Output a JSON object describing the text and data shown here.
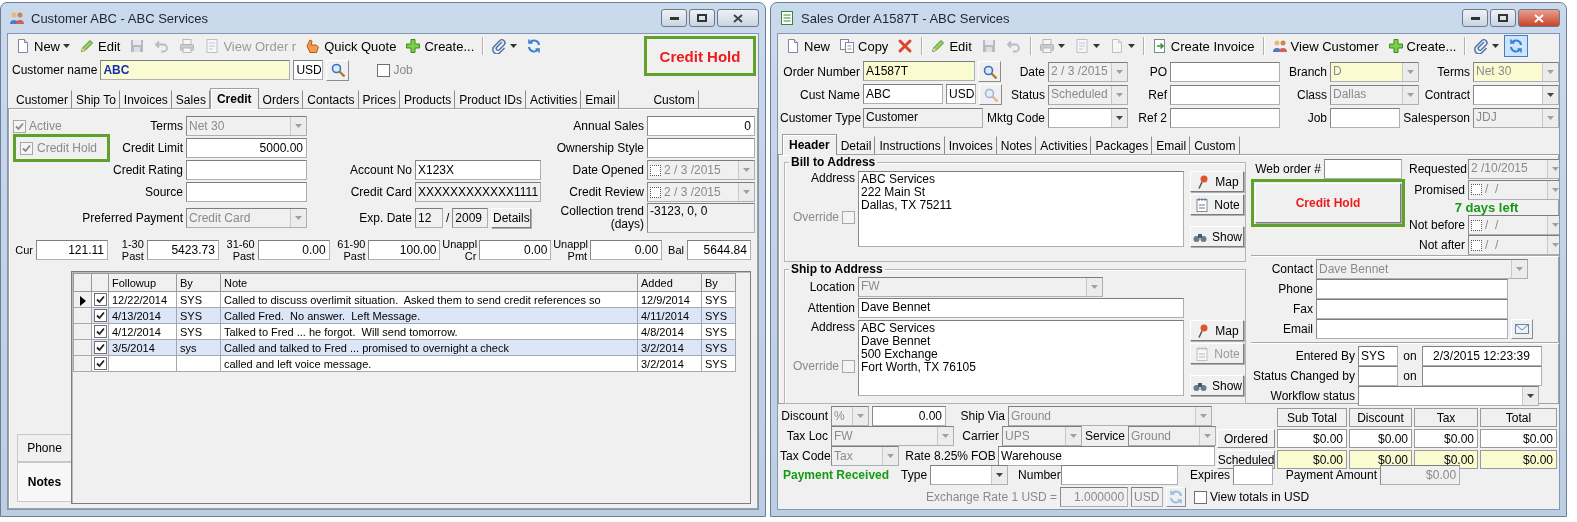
{
  "customer_window": {
    "title": "Customer ABC - ABC Services",
    "active": false,
    "toolbar": [
      {
        "kind": "new",
        "label": "New",
        "dropdown": true,
        "disabled": false
      },
      {
        "kind": "edit",
        "label": "Edit",
        "disabled": false
      },
      {
        "kind": "save",
        "disabled": true
      },
      {
        "kind": "undo",
        "disabled": true
      },
      {
        "kind": "print",
        "disabled": true
      },
      {
        "kind": "document",
        "label": "View Order r",
        "disabled": true
      },
      {
        "kind": "quote",
        "label": "Quick Quote",
        "disabled": false
      },
      {
        "kind": "create",
        "label": "Create...",
        "disabled": false
      },
      {
        "kind": "separator"
      },
      {
        "kind": "attach",
        "dropdown": true,
        "disabled": false
      },
      {
        "kind": "refresh",
        "disabled": false
      }
    ],
    "status_badge": "Credit Hold",
    "customer_name": {
      "label": "Customer name",
      "value": "ABC",
      "required": true,
      "lookup": {
        "disabled": false
      }
    },
    "currency": "USD",
    "job": {
      "label": "Job",
      "checked": false
    },
    "tabs": [
      {
        "label": "Customer",
        "selected": false
      },
      {
        "label": "Ship To",
        "selected": false
      },
      {
        "label": "Invoices",
        "selected": false
      },
      {
        "label": "Sales",
        "selected": false
      },
      {
        "label": "Credit",
        "selected": true
      },
      {
        "label": "Orders",
        "selected": false
      },
      {
        "label": "Contacts",
        "selected": false
      },
      {
        "label": "Prices",
        "selected": false
      },
      {
        "label": "Products",
        "selected": false
      },
      {
        "label": "Product IDs",
        "selected": false
      },
      {
        "label": "Activities",
        "selected": false
      },
      {
        "label": "Email",
        "selected": false
      },
      {
        "label": "Custom",
        "selected": false
      }
    ],
    "credit": {
      "active": {
        "label": "Active",
        "checked": true,
        "disabled": true
      },
      "credit_hold": {
        "label": "Credit Hold",
        "checked": true,
        "disabled": true
      },
      "terms": {
        "label": "Terms",
        "value": "Net 30",
        "kind": "combo",
        "disabled": true
      },
      "credit_limit": {
        "label": "Credit Limit",
        "value": "5000.00"
      },
      "credit_rating": {
        "label": "Credit Rating"
      },
      "source": {
        "label": "Source"
      },
      "preferred_payment": {
        "label": "Preferred Payment",
        "value": "Credit Card",
        "kind": "combo",
        "disabled": true
      },
      "account_no": {
        "label": "Account No",
        "value": "X123X"
      },
      "credit_card": {
        "label": "Credit Card",
        "value": "XXXXXXXXXXXX1111",
        "readonly": true
      },
      "exp_date": {
        "label": "Exp. Date",
        "month": "12",
        "separator": "/",
        "year": "2009",
        "readonly": true
      },
      "details_button": "Details",
      "annual_sales": {
        "label": "Annual Sales",
        "value": "0"
      },
      "ownership_style": {
        "label": "Ownership Style"
      },
      "date_opened": {
        "label": "Date Opened",
        "value": "2 / 3 /2015",
        "kind": "date",
        "disabled": true
      },
      "credit_review": {
        "label": "Credit Review",
        "value": "2 / 3 /2015",
        "kind": "date",
        "disabled": true
      },
      "collection_trend": {
        "label": "Collection trend (days)",
        "value": "-3123, 0, 0",
        "readonly": true
      }
    },
    "aging": [
      {
        "label": "Cur",
        "value": "121.11"
      },
      {
        "label": "1-30 Past",
        "value": "5423.73"
      },
      {
        "label": "31-60 Past",
        "value": "0.00"
      },
      {
        "label": "61-90 Past",
        "value": "100.00"
      },
      {
        "label": "Unappl Cr",
        "value": "0.00"
      },
      {
        "label": "Unappl Pmt",
        "value": "0.00"
      },
      {
        "label": "Bal",
        "value": "5644.84"
      }
    ],
    "side_tabs": [
      {
        "label": "Phone",
        "selected": false
      },
      {
        "label": "Notes",
        "selected": true
      }
    ],
    "notes_columns": [
      "Followup",
      "By",
      "Note",
      "Added",
      "By"
    ],
    "notes": [
      {
        "selected": true,
        "done": true,
        "followup": "12/22/2014",
        "by": "SYS",
        "note": "Called to discuss overlimit situation.  Asked them to send credit references so",
        "added": "12/9/2014",
        "added_by": "SYS"
      },
      {
        "selected": false,
        "done": true,
        "followup": "4/13/2014",
        "by": "SYS",
        "note": "Called Fred.  No answer.  Left Message.",
        "added": "4/11/2014",
        "added_by": "SYS"
      },
      {
        "selected": false,
        "done": true,
        "followup": "4/12/2014",
        "by": "SYS",
        "note": "Talked to Fred ... he forgot.  Will send tomorrow.",
        "added": "4/8/2014",
        "added_by": "SYS"
      },
      {
        "selected": false,
        "done": true,
        "followup": "3/5/2014",
        "by": "sys",
        "note": "Called and talked to Fred ... promised to overnight a check",
        "added": "3/2/2014",
        "added_by": "SYS"
      },
      {
        "selected": false,
        "done": true,
        "note": "called and left voice message.",
        "added": "3/2/2014",
        "added_by": "SYS"
      }
    ]
  },
  "order_window": {
    "title": "Sales Order A1587T - ABC Services",
    "active": true,
    "toolbar": [
      {
        "kind": "new",
        "label": "New",
        "disabled": false
      },
      {
        "kind": "copy",
        "label": "Copy",
        "disabled": false
      },
      {
        "kind": "delete",
        "disabled": false
      },
      {
        "kind": "separator"
      },
      {
        "kind": "edit",
        "label": "Edit",
        "disabled": false
      },
      {
        "kind": "save",
        "disabled": true
      },
      {
        "kind": "undo",
        "disabled": true
      },
      {
        "kind": "separator"
      },
      {
        "kind": "print",
        "dropdown": true,
        "disabled": true
      },
      {
        "kind": "document",
        "dropdown": true,
        "disabled": true
      },
      {
        "kind": "new",
        "dropdown": true,
        "disabled": true
      },
      {
        "kind": "separator"
      },
      {
        "kind": "invoice",
        "label": "Create Invoice",
        "disabled": false
      },
      {
        "kind": "separator"
      },
      {
        "kind": "customer",
        "label": "View Customer",
        "disabled": false
      },
      {
        "kind": "create",
        "label": "Create...",
        "disabled": false
      },
      {
        "kind": "separator"
      },
      {
        "kind": "attach",
        "dropdown": true,
        "disabled": false
      },
      {
        "kind": "refresh",
        "pressed": true,
        "disabled": false
      }
    ],
    "fields": {
      "order_number": {
        "label": "Order Number",
        "value": "A1587T",
        "required": true,
        "lookup": {
          "disabled": false
        }
      },
      "date": {
        "label": "Date",
        "value": "2 / 3 /2015",
        "kind": "combo",
        "disabled": true
      },
      "po": {
        "label": "PO"
      },
      "branch": {
        "label": "Branch",
        "value": "D",
        "kind": "combo",
        "required": true,
        "disabled": true
      },
      "terms": {
        "label": "Terms",
        "value": "Net 30",
        "kind": "combo",
        "required": true,
        "disabled": true
      },
      "cust_name": {
        "label": "Cust Name",
        "value": "ABC",
        "lookup": {
          "disabled": true
        }
      },
      "currency": "USD",
      "status": {
        "label": "Status",
        "value": "Scheduled",
        "kind": "combo",
        "disabled": true
      },
      "ref": {
        "label": "Ref"
      },
      "class": {
        "label": "Class",
        "value": "Dallas",
        "kind": "combo",
        "disabled": true
      },
      "contract": {
        "label": "Contract",
        "kind": "combo"
      },
      "customer_type": {
        "label": "Customer Type",
        "value": "Customer",
        "readonly": true
      },
      "mktg_code": {
        "label": "Mktg Code",
        "kind": "combo"
      },
      "ref_2": {
        "label": "Ref 2"
      },
      "job": {
        "label": "Job"
      },
      "salesperson": {
        "label": "Salesperson",
        "value": "JDJ",
        "kind": "combo",
        "disabled": true
      }
    },
    "tabs": [
      {
        "label": "Header",
        "selected": true
      },
      {
        "label": "Detail",
        "selected": false
      },
      {
        "label": "Instructions",
        "selected": false
      },
      {
        "label": "Invoices",
        "selected": false
      },
      {
        "label": "Notes",
        "selected": false
      },
      {
        "label": "Activities",
        "selected": false
      },
      {
        "label": "Packages",
        "selected": false
      },
      {
        "label": "Email",
        "selected": false
      },
      {
        "label": "Custom",
        "selected": false
      }
    ],
    "bill_to": {
      "title": "Bill to Address",
      "address": {
        "label": "Address",
        "value": "ABC Services\n222 Main St\nDallas, TX 75211"
      },
      "override": {
        "label": "Override",
        "checked": false,
        "disabled": true
      },
      "buttons": [
        {
          "kind": "map",
          "label": "Map",
          "disabled": false
        },
        {
          "kind": "note",
          "label": "Note",
          "disabled": false
        },
        {
          "kind": "show",
          "label": "Show",
          "disabled": false
        }
      ]
    },
    "ship_to": {
      "title": "Ship to Address",
      "location": {
        "label": "Location",
        "value": "FW",
        "kind": "combo",
        "disabled": true
      },
      "attention": {
        "label": "Attention",
        "value": "Dave Bennet"
      },
      "address": {
        "label": "Address",
        "value": "ABC Services\nDave Bennet\n500 Exchange\nFort Worth, TX 76105"
      },
      "override": {
        "label": "Override",
        "checked": false,
        "disabled": true
      },
      "buttons": [
        {
          "kind": "map",
          "label": "Map",
          "disabled": false
        },
        {
          "kind": "note",
          "label": "Note",
          "disabled": true
        },
        {
          "kind": "show",
          "label": "Show",
          "disabled": false
        }
      ]
    },
    "web_order": {
      "label": "Web order #"
    },
    "credit_hold_button": "Credit Hold",
    "requested": {
      "label": "Requested",
      "value": "2 /10/2015",
      "kind": "combo",
      "disabled": true
    },
    "promised": {
      "label": "Promised",
      "value": "/  /",
      "kind": "date",
      "disabled": true
    },
    "days_left": "7 days left",
    "not_before": {
      "label": "Not before",
      "value": "/  /",
      "kind": "date",
      "disabled": true
    },
    "not_after": {
      "label": "Not after",
      "value": "/  /",
      "kind": "date",
      "disabled": true
    },
    "contact": {
      "label": "Contact",
      "value": "Dave Bennet",
      "kind": "combo",
      "disabled": true
    },
    "phone": {
      "label": "Phone"
    },
    "fax": {
      "label": "Fax"
    },
    "email": {
      "label": "Email"
    },
    "entered_by": {
      "label": "Entered By",
      "value": "SYS",
      "on_label": "on",
      "on_value": "2/3/2015 12:23:39"
    },
    "status_changed_by": {
      "label": "Status Changed by",
      "on_label": "on"
    },
    "workflow_status": {
      "label": "Workflow status",
      "kind": "combo"
    },
    "discount": {
      "label": "Discount",
      "unit": {
        "value": "%",
        "kind": "combo",
        "disabled": true
      },
      "amount": {
        "value": "0.00"
      }
    },
    "ship_via": {
      "label": "Ship Via",
      "value": "Ground",
      "kind": "combo",
      "disabled": true
    },
    "tax_loc": {
      "label": "Tax Loc",
      "value": "FW",
      "kind": "combo",
      "disabled": true
    },
    "carrier": {
      "label": "Carrier",
      "value": "UPS",
      "kind": "combo",
      "disabled": true
    },
    "service": {
      "label": "Service",
      "value": "Ground",
      "kind": "combo",
      "disabled": true
    },
    "tax_code": {
      "label": "Tax Code",
      "value": "Tax",
      "kind": "combo",
      "disabled": true
    },
    "rate": "Rate 8.25%",
    "fob": {
      "label": "FOB",
      "value": "Warehouse"
    },
    "totals": {
      "columns": [
        "Sub Total",
        "Discount",
        "Tax",
        "Total"
      ],
      "rows": [
        {
          "label": "Ordered",
          "values": [
            "$0.00",
            "$0.00",
            "$0.00",
            "$0.00"
          ],
          "required": false
        },
        {
          "label": "Scheduled",
          "values": [
            "$0.00",
            "$0.00",
            "$0.00",
            "$0.00"
          ],
          "required": true
        }
      ]
    },
    "payment": {
      "title": "Payment Received",
      "type": {
        "label": "Type",
        "kind": "combo"
      },
      "number": {
        "label": "Number"
      },
      "expires": {
        "label": "Expires"
      },
      "amount": {
        "label": "Payment Amount",
        "value": "$0.00",
        "disabled": true
      }
    },
    "exchange": {
      "label": "Exchange Rate 1 USD =",
      "value": "1.000000",
      "currency": "USD",
      "disabled": true
    },
    "view_totals": {
      "label": "View totals in USD",
      "checked": false
    }
  }
}
